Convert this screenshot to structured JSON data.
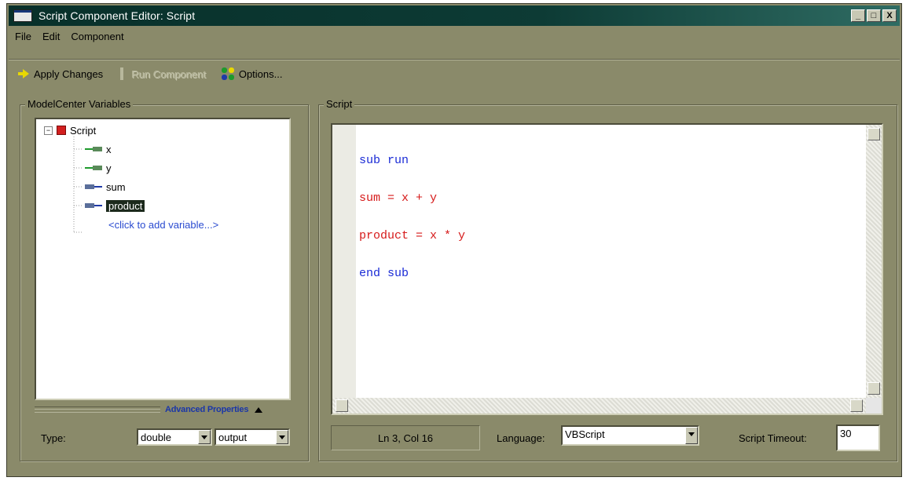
{
  "window": {
    "title": "Script Component Editor: Script",
    "buttons": [
      "_",
      "□",
      "X"
    ]
  },
  "menu": [
    "File",
    "Edit",
    "Component"
  ],
  "toolbar": {
    "apply_label": "Apply Changes",
    "run_label": "Run Component",
    "options_label": "Options..."
  },
  "variables_panel": {
    "title": "ModelCenter Variables",
    "tree": {
      "root_label": "Script",
      "items": [
        {
          "label": "x",
          "kind": "input"
        },
        {
          "label": "y",
          "kind": "input"
        },
        {
          "label": "sum",
          "kind": "output"
        },
        {
          "label": "product",
          "kind": "output",
          "selected": true
        }
      ],
      "add_label": "<click to add variable...>"
    },
    "advanced_label": "Advanced Properties",
    "type_label": "Type:",
    "type_value": "double",
    "direction_value": "output"
  },
  "script_panel": {
    "title": "Script",
    "code": [
      {
        "text": "sub run",
        "style": "kw"
      },
      {
        "text": "sum = x + y",
        "style": "ex"
      },
      {
        "text": "product = x * y",
        "style": "ex"
      },
      {
        "text": "end sub",
        "style": "kw"
      }
    ],
    "position": "Ln 3, Col 16",
    "language_label": "Language:",
    "language_value": "VBScript",
    "timeout_label": "Script Timeout:",
    "timeout_value": "30"
  },
  "colors": {
    "window_bg": "#8a8a6a",
    "title_bg": "#0d3b35",
    "keyword": "#1a2bd6",
    "expression": "#d61a1a",
    "link": "#2a4bd0"
  }
}
